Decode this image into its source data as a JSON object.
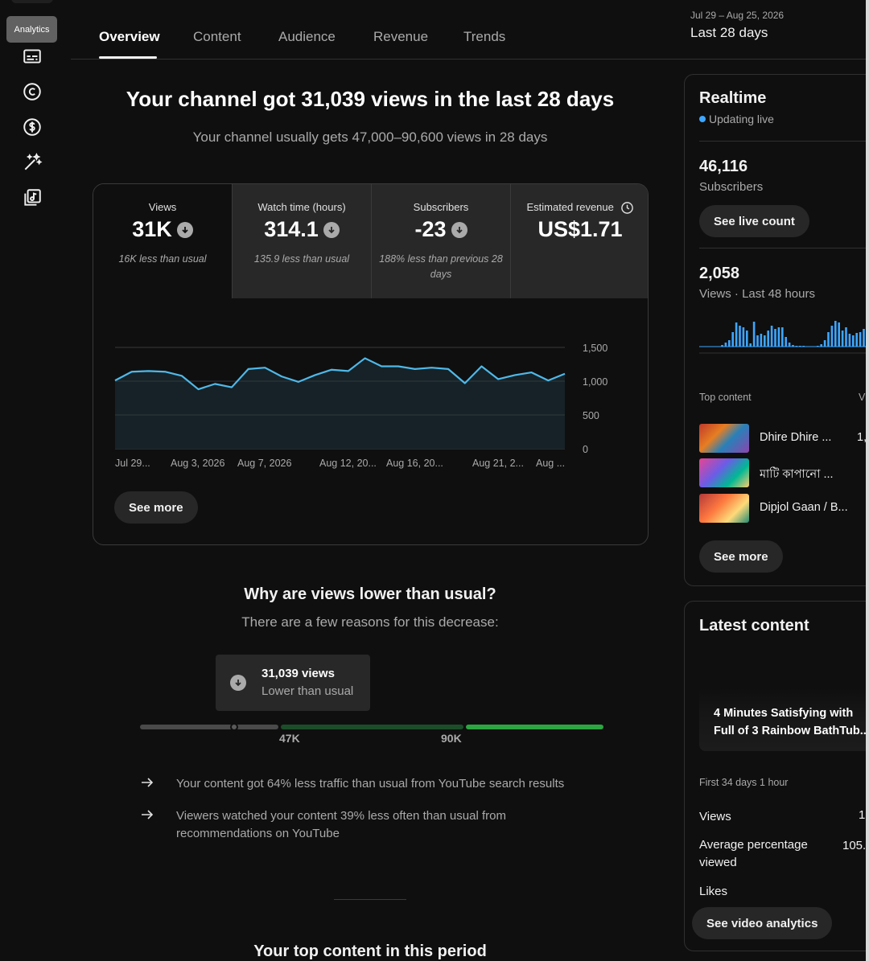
{
  "sidebar": {
    "tooltip": "Analytics",
    "icons": [
      "subtitles-icon",
      "copyright-icon",
      "monetization-icon",
      "customization-icon",
      "audio-library-icon"
    ]
  },
  "tabs": [
    {
      "label": "Overview",
      "active": true
    },
    {
      "label": "Content",
      "active": false
    },
    {
      "label": "Audience",
      "active": false
    },
    {
      "label": "Revenue",
      "active": false
    },
    {
      "label": "Trends",
      "active": false
    }
  ],
  "date_range": {
    "dates": "Jul 29 – Aug 25, 2026",
    "label": "Last 28 days"
  },
  "summary": {
    "headline": "Your channel got 31,039 views in the last 28 days",
    "subhead": "Your channel usually gets 47,000–90,600 views in 28 days"
  },
  "metrics": [
    {
      "label": "Views",
      "value": "31K",
      "note": "16K less than usual",
      "trend": "down"
    },
    {
      "label": "Watch time (hours)",
      "value": "314.1",
      "note": "135.9 less than usual",
      "trend": "down"
    },
    {
      "label": "Subscribers",
      "value": "-23",
      "note": "188% less than previous 28 days",
      "trend": "down"
    },
    {
      "label": "Estimated revenue",
      "value": "US$1.71",
      "note": "",
      "trend": "none"
    }
  ],
  "chart_data": {
    "type": "area",
    "x_labels": [
      "Jul 29...",
      "Aug 3, 2026",
      "Aug 7, 2026",
      "Aug 12, 20...",
      "Aug 16, 20...",
      "Aug 21, 2...",
      "Aug ..."
    ],
    "ylim": [
      0,
      1500
    ],
    "y_ticks": [
      "1,500",
      "1,000",
      "500",
      "0"
    ],
    "series": [
      {
        "values": [
          1010,
          1140,
          1150,
          1140,
          1080,
          880,
          960,
          910,
          1180,
          1200,
          1070,
          990,
          1090,
          1170,
          1150,
          1340,
          1220,
          1220,
          1180,
          1200,
          1180,
          970,
          1220,
          1030,
          1090,
          1130,
          1010,
          1110
        ]
      }
    ],
    "colors": {
      "line": "#4fb8e8",
      "fill": "#162227",
      "grid": "#3a3a3a"
    }
  },
  "see_more_label": "See more",
  "why": {
    "title": "Why are views lower than usual?",
    "subtitle": "There are a few reasons for this decrease:",
    "current_value": "31,039 views",
    "current_label": "Lower than usual",
    "range_low": "47K",
    "range_high": "90K",
    "reasons": [
      "Your content got 64% less traffic than usual from YouTube search results",
      "Viewers watched your content 39% less often than usual from recommendations on YouTube"
    ]
  },
  "top_content_heading": "Your top content in this period",
  "realtime": {
    "title": "Realtime",
    "status": "Updating live",
    "subscribers_value": "46,116",
    "subscribers_label": "Subscribers",
    "live_count_label": "See live count",
    "views_value": "2,058",
    "views_label": "Views · Last 48 hours",
    "bars": [
      0,
      0,
      0,
      2,
      5,
      8,
      18,
      30,
      26,
      24,
      20,
      4,
      31,
      14,
      16,
      14,
      20,
      26,
      22,
      24,
      24,
      12,
      5,
      2,
      1,
      1,
      1,
      0,
      0,
      0,
      1,
      3,
      8,
      18,
      26,
      32,
      30,
      20,
      24,
      16,
      14,
      17,
      18,
      22,
      26,
      18
    ],
    "top_content_label": "Top content",
    "top_content_col": "Vi",
    "top_items": [
      {
        "title": "Dhire Dhire ...",
        "value": "1,"
      },
      {
        "title": "মাটি কাপানো ...",
        "value": ""
      },
      {
        "title": "Dipjol Gaan / B...",
        "value": ""
      }
    ],
    "see_more_label": "See more"
  },
  "latest": {
    "title": "Latest content",
    "video_title": "4 Minutes Satisfying with Full of 3 Rainbow BathTub...",
    "period": "First 34 days 1 hour",
    "stats": [
      {
        "label": "Views",
        "value": "1"
      },
      {
        "label": "Average percentage viewed",
        "value": "105."
      },
      {
        "label": "Likes",
        "value": ""
      }
    ],
    "cta": "See video analytics"
  },
  "colors": {
    "accent_blue": "#3ea6ff",
    "chart_line": "#4fb8e8",
    "range_green": "#2ba640",
    "range_dark_green": "#1b4d28"
  }
}
